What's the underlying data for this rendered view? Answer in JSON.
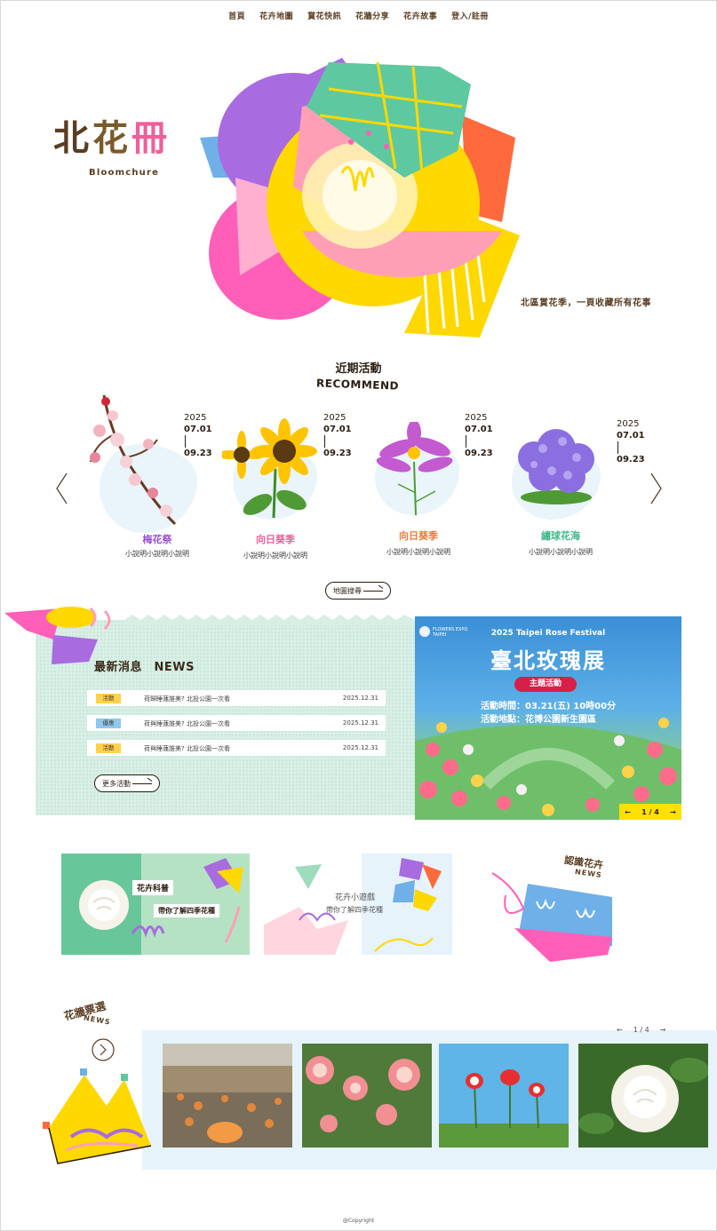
{
  "nav": {
    "items": [
      "首頁",
      "花卉地圖",
      "賞花快訊",
      "花牆分享",
      "花卉故事",
      "登入/註冊"
    ]
  },
  "logo": {
    "chars": [
      "北",
      "花",
      "冊"
    ],
    "subtitle": "Bloomchure"
  },
  "hero": {
    "slogan": "北區賞花季，一頁收藏所有花事"
  },
  "recommend": {
    "title": "近期活動",
    "subtitle": "RECOMMEND",
    "cards": [
      {
        "year": "2025",
        "start": "07.01",
        "end": "09.23",
        "name": "梅花祭",
        "desc": "小說明小說明小說明",
        "name_color": "#9b4fcf"
      },
      {
        "year": "2025",
        "start": "07.01",
        "end": "09.23",
        "name": "向日葵季",
        "desc": "小說明小說明小說明",
        "name_color": "#ef5f9a"
      },
      {
        "year": "2025",
        "start": "07.01",
        "end": "09.23",
        "name": "向日葵季",
        "desc": "小說明小說明小說明",
        "name_color": "#ef7a3a"
      },
      {
        "year": "2025",
        "start": "07.01",
        "end": "09.23",
        "name": "繡球花海",
        "desc": "小說明小說明小說明",
        "name_color": "#3fb88a"
      }
    ],
    "map_button": "地圖搜尋"
  },
  "news": {
    "title": "最新消息　NEWS",
    "rows": [
      {
        "tag": "活動",
        "tag_color": "#ffd24a",
        "text": "荷歸睡蓮誰美? 北投公園一次看",
        "date": "2025.12.31"
      },
      {
        "tag": "優惠",
        "tag_color": "#8cc8ef",
        "text": "荷與睡蓮誰美? 北投公園一次看",
        "date": "2025.12.31"
      },
      {
        "tag": "活動",
        "tag_color": "#ffd24a",
        "text": "荷與睡蓮誰美? 北投公園一次看",
        "date": "2025.12.31"
      }
    ],
    "more_button": "更多活動"
  },
  "banner": {
    "logo_text": "FLOWERS EXPO TAIPEI",
    "en_title": "2025 Taipei Rose Festival",
    "zh_title": "臺北玫瑰展",
    "tag": "主題活動",
    "time": "活動時間：03.21(五) 10時00分",
    "place": "活動地點：花博公園新生園區",
    "pager": "1 / 4",
    "prev": "←",
    "next": "→"
  },
  "features": {
    "science": {
      "label": "花卉科普",
      "text": "帶你了解四季花種"
    },
    "game": {
      "label": "花卉小遊戲",
      "text": "帶你了解四季花種"
    },
    "learn": {
      "label": "認識花卉",
      "sub": "NEWS"
    }
  },
  "vote": {
    "title": "花牆票選",
    "sub": "NEWS",
    "prev": "←",
    "pager": "1 / 4",
    "next": "→"
  },
  "footer": {
    "copyright": "@Copyright"
  },
  "colors": {
    "brown": "#5a3d22",
    "mint": "#d9efe6",
    "light_blue": "#e6f3fb"
  }
}
